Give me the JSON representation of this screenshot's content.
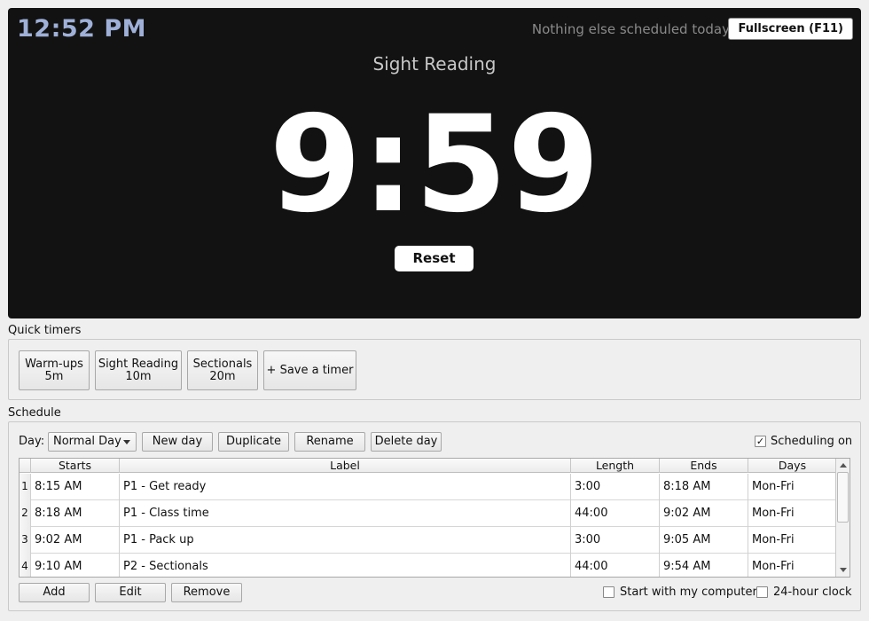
{
  "header": {
    "clock": "12:52 PM",
    "next_event": "Nothing else scheduled today",
    "fullscreen_label": "Fullscreen (F11)"
  },
  "timer": {
    "label": "Sight Reading",
    "remaining": "9:59",
    "reset_label": "Reset"
  },
  "quick_timers": {
    "title": "Quick timers",
    "items": [
      {
        "name": "Warm-ups",
        "length": "5m"
      },
      {
        "name": "Sight Reading",
        "length": "10m"
      },
      {
        "name": "Sectionals",
        "length": "20m"
      }
    ],
    "save_label": "+ Save a timer"
  },
  "schedule": {
    "title": "Schedule",
    "day_label": "Day:",
    "day_value": "Normal Day",
    "new_day_label": "New day",
    "duplicate_label": "Duplicate",
    "rename_label": "Rename",
    "delete_day_label": "Delete day",
    "scheduling_on_label": "Scheduling on",
    "scheduling_on_checked": true,
    "columns": [
      "Starts",
      "Label",
      "Length",
      "Ends",
      "Days"
    ],
    "rows": [
      {
        "num": "1",
        "starts": "8:15 AM",
        "label": "P1 - Get ready",
        "length": "3:00",
        "ends": "8:18 AM",
        "days": "Mon-Fri"
      },
      {
        "num": "2",
        "starts": "8:18 AM",
        "label": "P1 - Class time",
        "length": "44:00",
        "ends": "9:02 AM",
        "days": "Mon-Fri"
      },
      {
        "num": "3",
        "starts": "9:02 AM",
        "label": "P1 - Pack up",
        "length": "3:00",
        "ends": "9:05 AM",
        "days": "Mon-Fri"
      },
      {
        "num": "4",
        "starts": "9:10 AM",
        "label": "P2 - Sectionals",
        "length": "44:00",
        "ends": "9:54 AM",
        "days": "Mon-Fri"
      }
    ],
    "add_label": "Add",
    "edit_label": "Edit",
    "remove_label": "Remove",
    "start_with_computer_label": "Start with my computer",
    "start_with_computer_checked": false,
    "clock_24h_label": "24-hour clock",
    "clock_24h_checked": false
  },
  "colors": {
    "panel_bg": "#121212",
    "clock_accent": "#9fb0d8",
    "window_bg": "#efefef"
  }
}
